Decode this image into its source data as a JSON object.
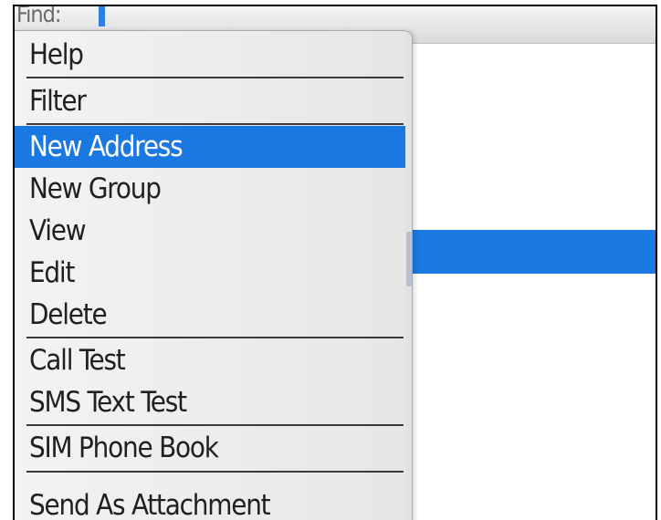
{
  "find": {
    "label": "Find:"
  },
  "menu": {
    "items": [
      {
        "label": "Help"
      },
      {
        "label": "Filter"
      },
      {
        "label": "New Address"
      },
      {
        "label": "New Group"
      },
      {
        "label": "View"
      },
      {
        "label": "Edit"
      },
      {
        "label": "Delete"
      },
      {
        "label": "Call Test"
      },
      {
        "label": "SMS Text Test"
      },
      {
        "label": "SIM Phone Book"
      },
      {
        "label": "Send As Attachment"
      }
    ],
    "selected_index": 2
  },
  "colors": {
    "selection": "#1a78e2",
    "menu_background": "#ececec",
    "cursor": "#2f7fe0"
  }
}
